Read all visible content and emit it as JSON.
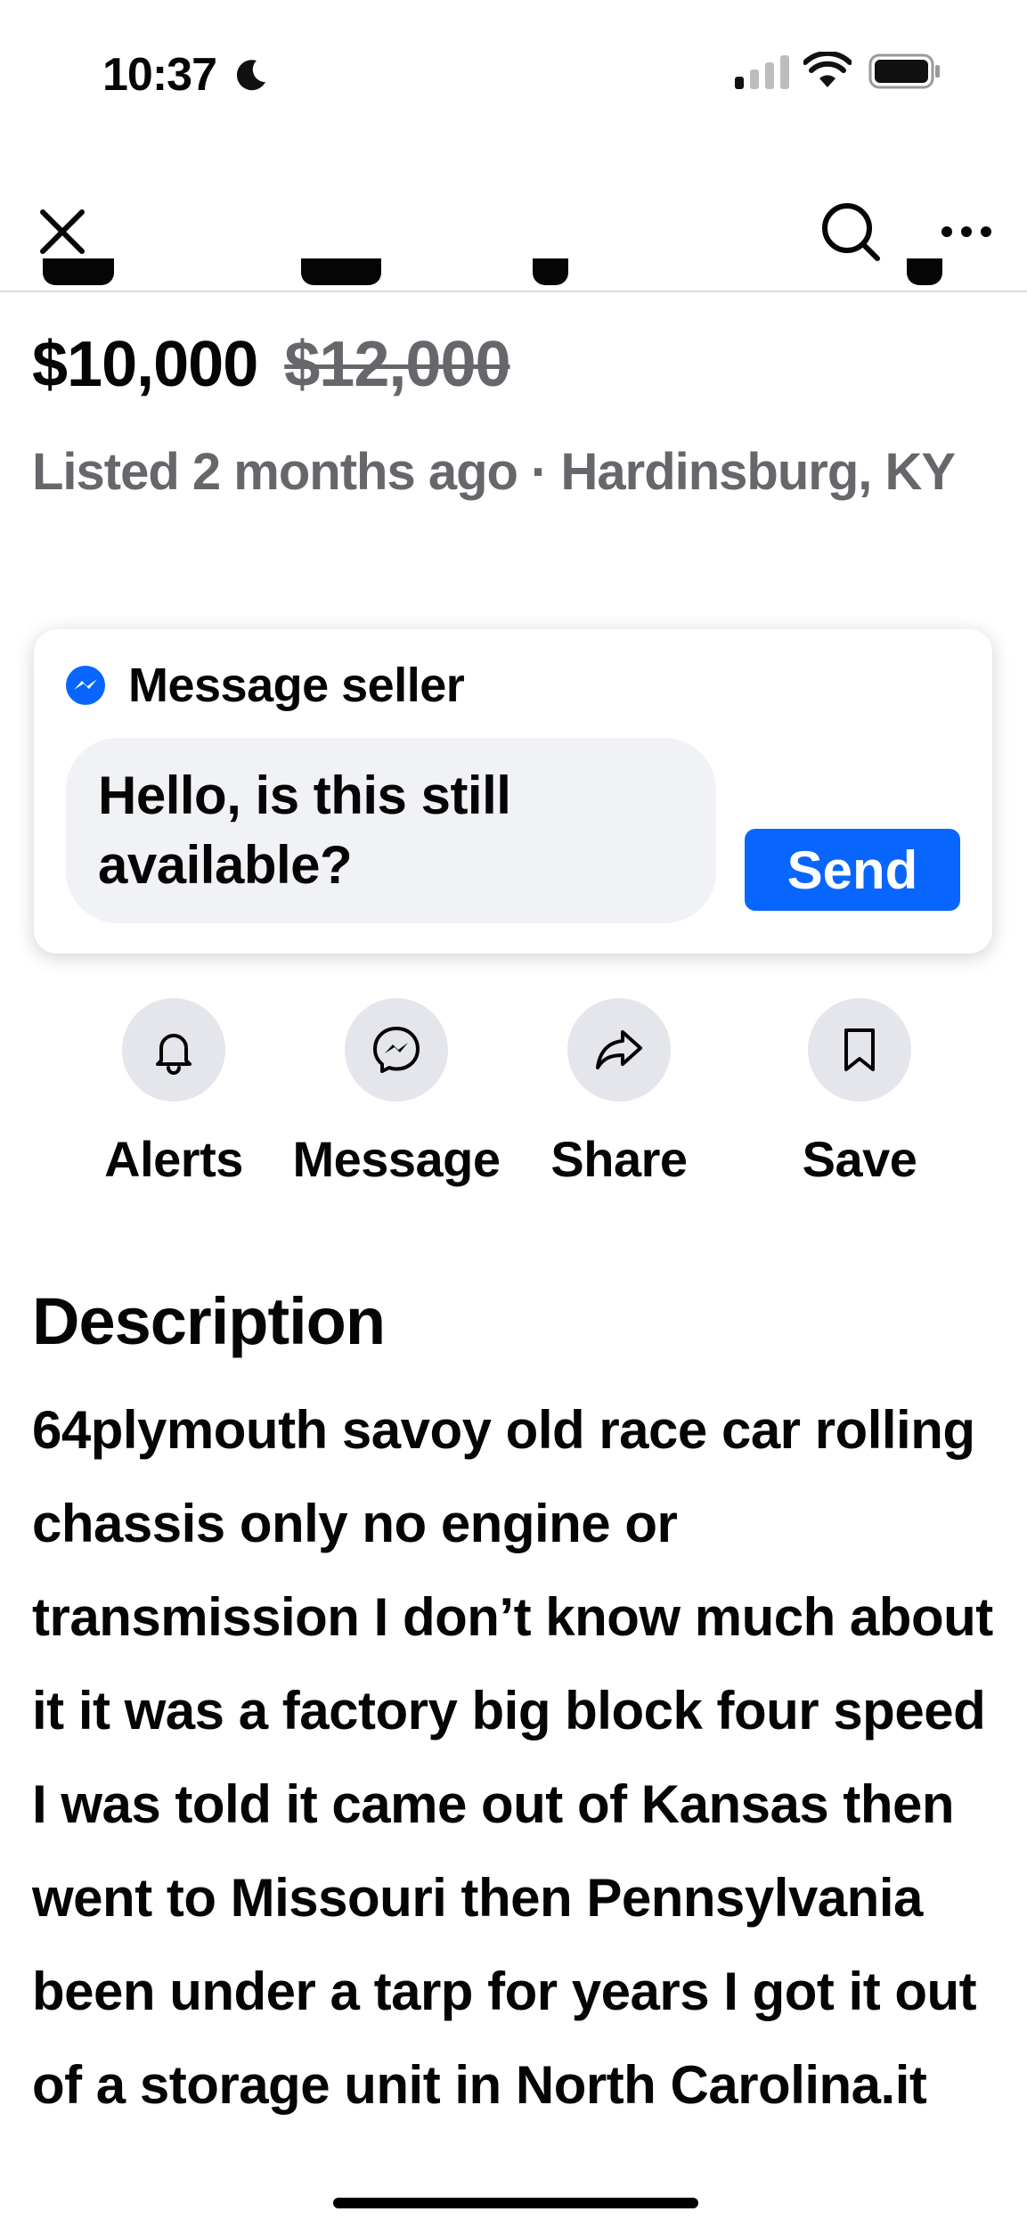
{
  "status_bar": {
    "time": "10:37"
  },
  "listing": {
    "price": "$10,000",
    "original_price": "$12,000",
    "listed_info": "Listed 2 months ago · Hardinsburg, KY"
  },
  "message_card": {
    "heading": "Message seller",
    "input_value": "Hello, is this still available?",
    "send_label": "Send"
  },
  "actions": [
    {
      "label": "Alerts",
      "icon": "bell-icon"
    },
    {
      "label": "Message",
      "icon": "messenger-icon"
    },
    {
      "label": "Share",
      "icon": "share-icon"
    },
    {
      "label": "Save",
      "icon": "bookmark-icon"
    }
  ],
  "description": {
    "heading": "Description",
    "text": "64plymouth savoy old race car rolling chassis only no engine or transmission I don’t know much about it it was a factory big block four speed I was told it came out of Kansas then went to Missouri then Pennsylvania been under a tarp for years I got it out of a storage unit in North Carolina.it"
  },
  "colors": {
    "accent": "#0866ff",
    "secondary_text": "#65676b",
    "chip_bg": "#e4e6eb",
    "input_bg": "#f0f2f5"
  }
}
